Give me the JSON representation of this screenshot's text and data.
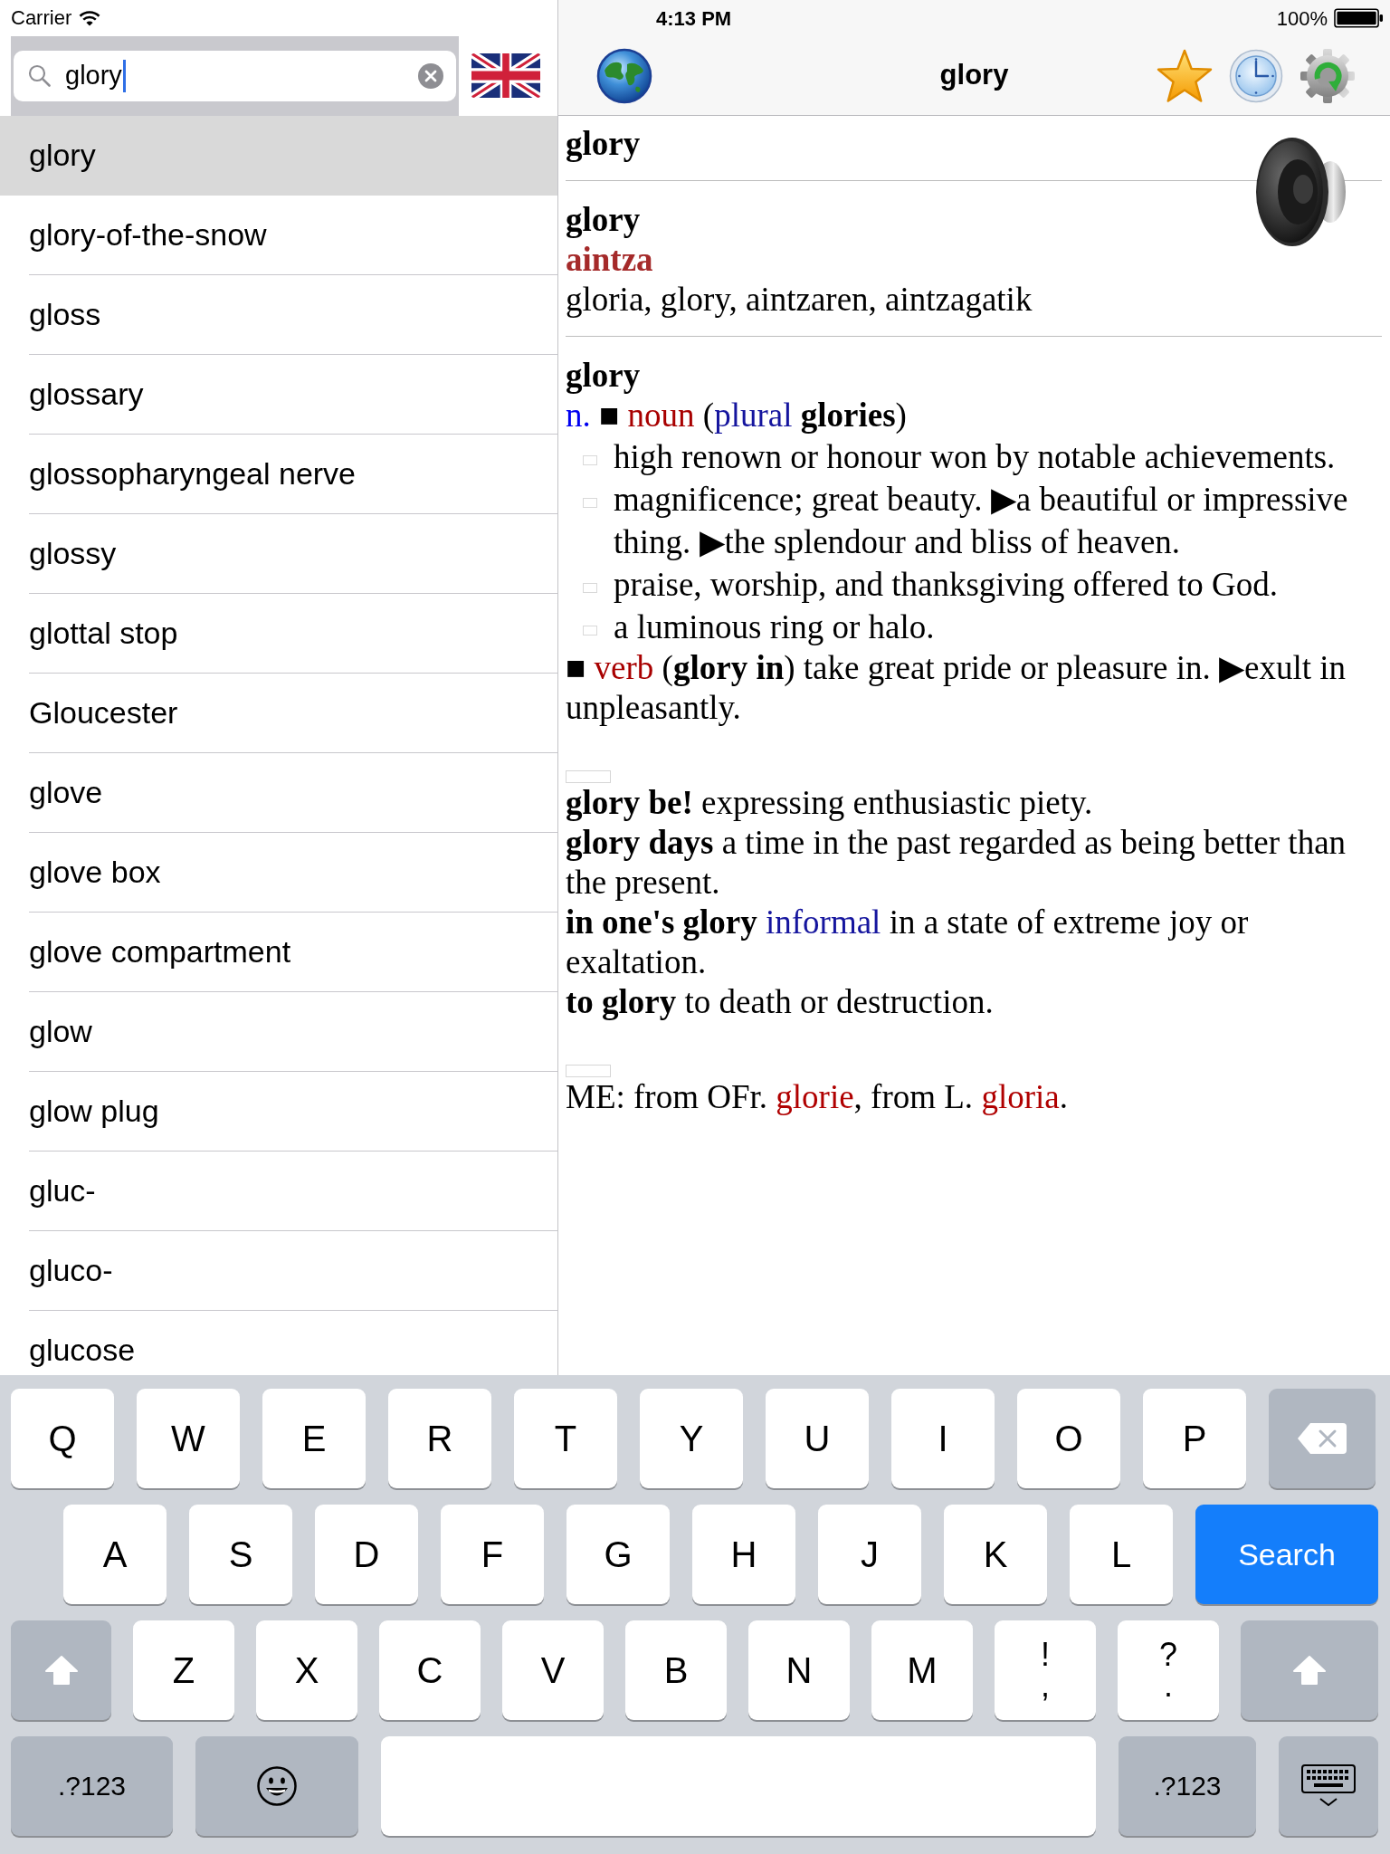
{
  "status_bar": {
    "carrier": "Carrier",
    "time": "4:13 PM",
    "battery": "100%"
  },
  "search": {
    "value": "glory"
  },
  "word_list": [
    {
      "text": "glory",
      "selected": true
    },
    {
      "text": "glory-of-the-snow",
      "selected": false
    },
    {
      "text": "gloss",
      "selected": false
    },
    {
      "text": "glossary",
      "selected": false
    },
    {
      "text": "glossopharyngeal nerve",
      "selected": false
    },
    {
      "text": "glossy",
      "selected": false
    },
    {
      "text": "glottal stop",
      "selected": false
    },
    {
      "text": "Gloucester",
      "selected": false
    },
    {
      "text": "glove",
      "selected": false
    },
    {
      "text": "glove box",
      "selected": false
    },
    {
      "text": "glove compartment",
      "selected": false
    },
    {
      "text": "glow",
      "selected": false
    },
    {
      "text": "glow plug",
      "selected": false
    },
    {
      "text": "gluc-",
      "selected": false
    },
    {
      "text": "gluco-",
      "selected": false
    },
    {
      "text": "glucose",
      "selected": false
    }
  ],
  "nav_bar": {
    "title": "glory"
  },
  "article": {
    "sections": [
      {
        "divider": true,
        "lines": [
          {
            "kind": "headword",
            "text": "glory"
          }
        ]
      },
      {
        "divider": true,
        "lines": [
          {
            "kind": "headword",
            "text": "glory"
          },
          {
            "kind": "translation",
            "text": "aintza"
          },
          {
            "kind": "text",
            "text": "gloria, glory, aintzaren, aintzagatik"
          }
        ]
      },
      {
        "divider": false,
        "lines": [
          {
            "kind": "headword",
            "text": "glory"
          },
          {
            "kind": "text",
            "segments": [
              {
                "kind": "abbreviation",
                "text": "n."
              },
              {
                "kind": "plain",
                "text": " ■ "
              },
              {
                "kind": "part_of_speech",
                "text": "noun"
              },
              {
                "kind": "plain",
                "text": " ("
              },
              {
                "kind": "label",
                "text": "plural"
              },
              {
                "kind": "plain",
                "text": " **glories**)"
              }
            ]
          },
          {
            "kind": "sense",
            "text": "high renown or honour won by notable achievements."
          },
          {
            "kind": "sense",
            "text": "magnificence; great beauty. ▶a beautiful or impressive thing. ▶the splendour and bliss of heaven."
          },
          {
            "kind": "sense",
            "text": "praise, worship, and thanksgiving offered to God."
          },
          {
            "kind": "sense",
            "text": "a luminous ring or halo."
          },
          {
            "kind": "text",
            "segments": [
              {
                "kind": "plain",
                "text": "■ "
              },
              {
                "kind": "part_of_speech",
                "text": "verb"
              },
              {
                "kind": "plain",
                "text": " (**glory in**) take great pride or pleasure in. ▶exult in unpleasantly."
              }
            ]
          },
          {
            "kind": "marker"
          },
          {
            "kind": "text",
            "text": "**glory be!** expressing enthusiastic piety."
          },
          {
            "kind": "text",
            "text": "**glory days** a time in the past regarded as being better than the present."
          },
          {
            "kind": "text",
            "segments": [
              {
                "kind": "plain",
                "text": "**in one's glory** "
              },
              {
                "kind": "label",
                "text": "informal"
              },
              {
                "kind": "plain",
                "text": " in a state of extreme joy or exaltation."
              }
            ]
          },
          {
            "kind": "text",
            "text": "**to glory** to death or destruction."
          },
          {
            "kind": "marker"
          },
          {
            "kind": "text",
            "segments": [
              {
                "kind": "plain",
                "text": "ME: from OFr. "
              },
              {
                "kind": "etymon",
                "text": "glorie"
              },
              {
                "kind": "plain",
                "text": ", from L. "
              },
              {
                "kind": "etymon",
                "text": "gloria"
              },
              {
                "kind": "plain",
                "text": "."
              }
            ]
          }
        ]
      }
    ]
  },
  "keyboard": {
    "rows": [
      {
        "keys": [
          {
            "kind": "letter",
            "label": "Q"
          },
          {
            "kind": "letter",
            "label": "W"
          },
          {
            "kind": "letter",
            "label": "E"
          },
          {
            "kind": "letter",
            "label": "R"
          },
          {
            "kind": "letter",
            "label": "T"
          },
          {
            "kind": "letter",
            "label": "Y"
          },
          {
            "kind": "letter",
            "label": "U"
          },
          {
            "kind": "letter",
            "label": "I"
          },
          {
            "kind": "letter",
            "label": "O"
          },
          {
            "kind": "letter",
            "label": "P"
          },
          {
            "kind": "backspace"
          }
        ]
      },
      {
        "keys": [
          {
            "kind": "letter",
            "label": "A"
          },
          {
            "kind": "letter",
            "label": "S"
          },
          {
            "kind": "letter",
            "label": "D"
          },
          {
            "kind": "letter",
            "label": "F"
          },
          {
            "kind": "letter",
            "label": "G"
          },
          {
            "kind": "letter",
            "label": "H"
          },
          {
            "kind": "letter",
            "label": "J"
          },
          {
            "kind": "letter",
            "label": "K"
          },
          {
            "kind": "letter",
            "label": "L"
          },
          {
            "kind": "search",
            "label": "Search"
          }
        ]
      },
      {
        "keys": [
          {
            "kind": "shift"
          },
          {
            "kind": "letter",
            "label": "Z"
          },
          {
            "kind": "letter",
            "label": "X"
          },
          {
            "kind": "letter",
            "label": "C"
          },
          {
            "kind": "letter",
            "label": "V"
          },
          {
            "kind": "letter",
            "label": "B"
          },
          {
            "kind": "letter",
            "label": "N"
          },
          {
            "kind": "letter",
            "label": "M"
          },
          {
            "kind": "dual",
            "label": "!",
            "secondary": ","
          },
          {
            "kind": "dual",
            "label": "?",
            "secondary": "."
          },
          {
            "kind": "shift"
          }
        ]
      },
      {
        "keys": [
          {
            "kind": "mode",
            "label": ".?123"
          },
          {
            "kind": "emoji"
          },
          {
            "kind": "space"
          },
          {
            "kind": "mode",
            "label": ".?123"
          },
          {
            "kind": "dismiss"
          }
        ]
      }
    ]
  }
}
